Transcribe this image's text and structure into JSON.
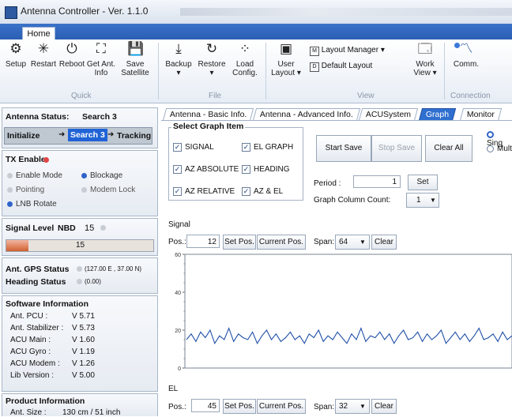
{
  "window": {
    "title": "Antenna Controller - Ver. 1.1.0"
  },
  "ribbon": {
    "tab": "Home",
    "buttons": {
      "setup": "Setup",
      "restart": "Restart",
      "reboot": "Reboot",
      "get_ant_info_l1": "Get Ant.",
      "get_ant_info_l2": "Info",
      "save_satellite_l1": "Save",
      "save_satellite_l2": "Satellite",
      "backup": "Backup",
      "restore": "Restore",
      "load_config_l1": "Load",
      "load_config_l2": "Config.",
      "user_layout_l1": "User",
      "user_layout_l2": "Layout",
      "layout_manager": "Layout Manager",
      "default_layout": "Default Layout",
      "work_view_l1": "Work",
      "work_view_l2": "View",
      "comm": "Comm."
    },
    "groups": {
      "quick": "Quick",
      "file": "File",
      "view": "View",
      "connection": "Connection"
    }
  },
  "left": {
    "antenna_status": {
      "label": "Antenna Status:",
      "value": "Search 3",
      "steps": [
        "Initialize",
        "Search 3",
        "Tracking"
      ]
    },
    "tx_enable": {
      "label": "TX Enable",
      "items": [
        "Enable Mode",
        "Blockage",
        "Pointing",
        "Modem Lock",
        "LNB Rotate"
      ]
    },
    "signal_level": {
      "label": "Signal Level",
      "mode": "NBD",
      "value": "15",
      "bar_value": "15",
      "bar_fraction": 0.15
    },
    "gps": {
      "ant_gps_label": "Ant. GPS Status",
      "ant_gps_value": "(127.00 E , 37.00 N)",
      "heading_label": "Heading Status",
      "heading_value": "(0.00)"
    },
    "software": {
      "title": "Software Information",
      "rows": [
        {
          "k": "Ant. PCU :",
          "v": "V 5.71"
        },
        {
          "k": "Ant. Stabilizer :",
          "v": "V 5.73"
        },
        {
          "k": "ACU Main :",
          "v": "V 1.60"
        },
        {
          "k": "ACU Gyro :",
          "v": "V 1.19"
        },
        {
          "k": "ACU Modem :",
          "v": "V 1.26"
        },
        {
          "k": "Lib Version :",
          "v": "V 5.00"
        }
      ]
    },
    "product": {
      "title": "Product Information",
      "size_label": "Ant. Size :",
      "size_value": "130 cm / 51 inch"
    }
  },
  "tabs": [
    "Antenna - Basic Info.",
    "Antenna - Advanced Info.",
    "ACUSystem",
    "Graph",
    "Monitor"
  ],
  "graph_panel": {
    "select_title": "Select Graph Item",
    "items": [
      "SIGNAL",
      "EL GRAPH",
      "AZ ABSOLUTE",
      "HEADING",
      "AZ RELATIVE",
      "AZ & EL"
    ],
    "start_save": "Start Save",
    "stop_save": "Stop Save",
    "clear_all": "Clear All",
    "radio_single": "Sing",
    "radio_multi": "Mult",
    "period_label": "Period :",
    "period_value": "1",
    "set": "Set",
    "column_count_label": "Graph Column Count:",
    "column_count_value": "1"
  },
  "signal_graph": {
    "label": "Signal",
    "pos_label": "Pos.:",
    "pos_value": "12",
    "set_pos": "Set Pos.",
    "current_pos": "Current Pos.",
    "span_label": "Span:",
    "span_value": "64",
    "clear": "Clear"
  },
  "chart_data": {
    "type": "line",
    "title": "",
    "xlabel": "",
    "ylabel": "",
    "ylim": [
      0,
      60
    ],
    "yticks": [
      "60",
      "40",
      "20",
      "0"
    ],
    "series": [
      {
        "values": [
          15,
          18,
          14,
          19,
          16,
          20,
          13,
          17,
          15,
          21,
          14,
          18,
          16,
          15,
          19,
          13,
          17,
          20,
          15,
          18,
          14,
          16,
          19,
          15,
          17,
          13,
          18,
          16,
          20,
          14,
          17,
          15,
          19,
          16,
          13,
          18,
          15,
          21,
          14,
          17,
          16,
          19,
          15,
          18,
          13,
          17,
          20,
          15,
          16,
          19,
          14,
          18,
          15,
          17,
          20,
          13,
          16,
          19,
          15,
          18,
          14,
          17,
          21,
          15,
          16,
          18,
          14,
          19,
          15,
          17
        ]
      }
    ]
  },
  "el_graph": {
    "label": "EL",
    "pos_label": "Pos.:",
    "pos_value": "45",
    "set_pos": "Set Pos.",
    "current_pos": "Current Pos.",
    "span_label": "Span:",
    "span_value": "32",
    "clear": "Clear"
  }
}
